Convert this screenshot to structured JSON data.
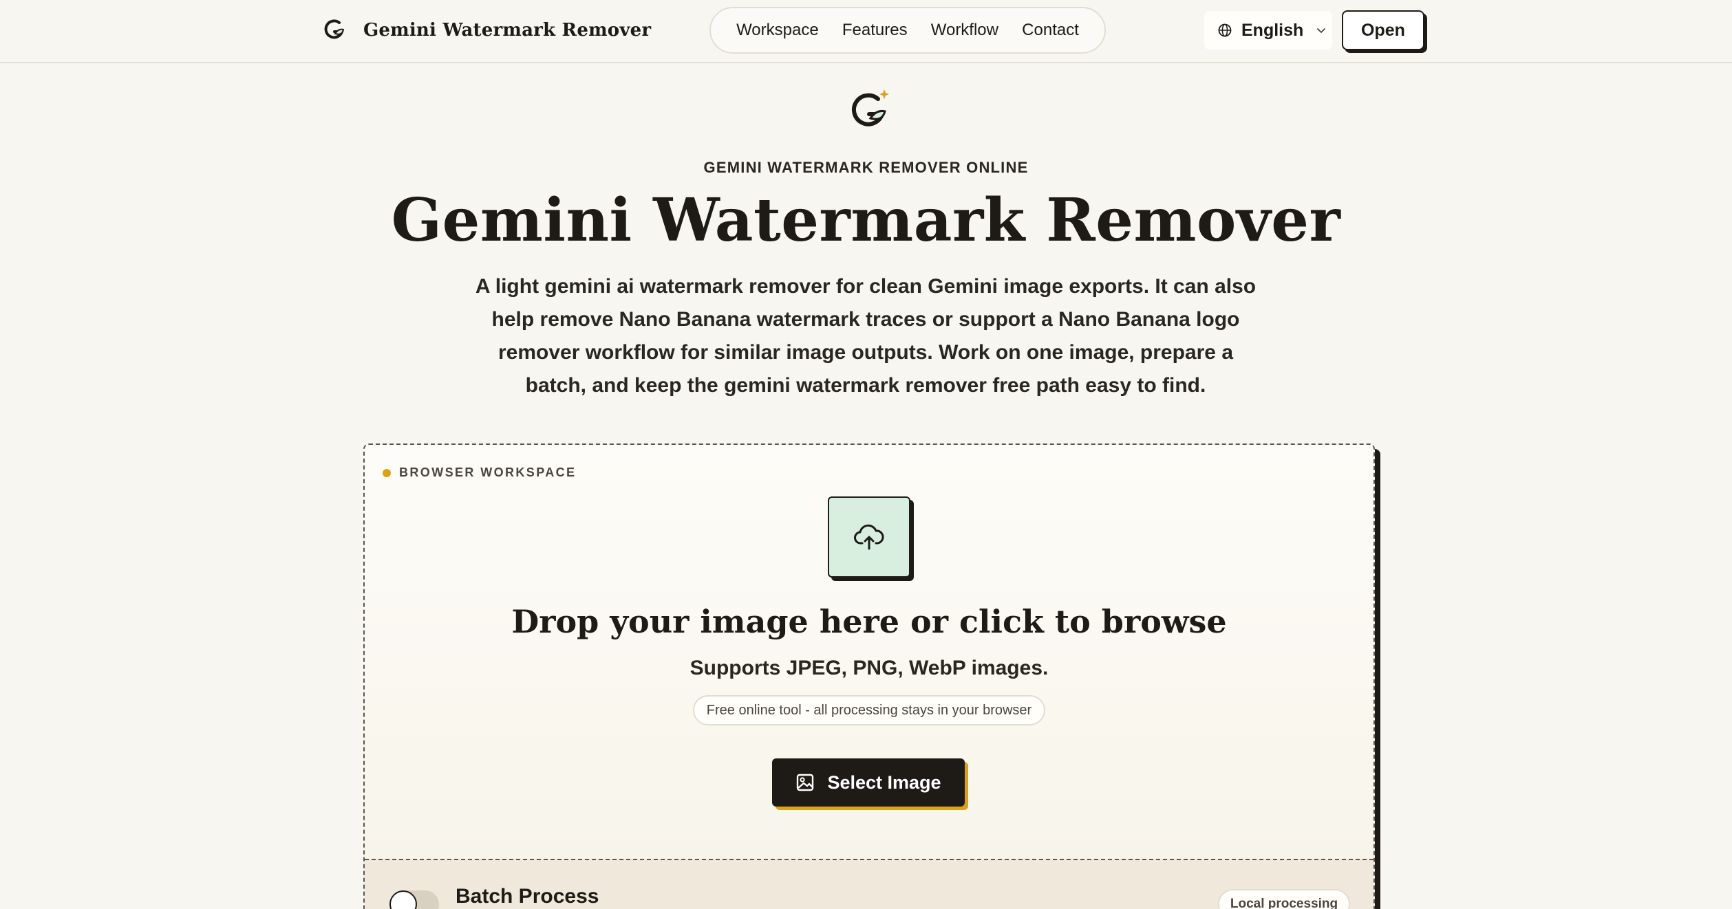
{
  "header": {
    "brand_name": "Gemini Watermark Remover",
    "nav": [
      "Workspace",
      "Features",
      "Workflow",
      "Contact"
    ],
    "language": "English",
    "open_label": "Open"
  },
  "hero": {
    "eyebrow": "GEMINI WATERMARK REMOVER ONLINE",
    "title": "Gemini Watermark Remover",
    "description": "A light gemini ai watermark remover for clean Gemini image exports. It can also help remove Nano Banana watermark traces or support a Nano Banana logo remover workflow for similar image outputs. Work on one image, prepare a batch, and keep the gemini watermark remover free path easy to find."
  },
  "workspace": {
    "label": "BROWSER WORKSPACE",
    "drop_title": "Drop your image here or click to browse",
    "supports": "Supports JPEG, PNG, WebP images.",
    "free_note": "Free online tool - all processing stays in your browser",
    "select_button": "Select Image",
    "batch_label": "Batch Process",
    "local_badge": "Local processing"
  },
  "colors": {
    "accent": "#d9a21b",
    "upload_tile": "#d8efe0",
    "ink": "#1e1b17",
    "background": "#f8f6f0"
  },
  "icons": [
    "gemini-g-logo-icon",
    "globe-icon",
    "chevron-down-icon",
    "cloud-upload-icon",
    "image-icon"
  ]
}
